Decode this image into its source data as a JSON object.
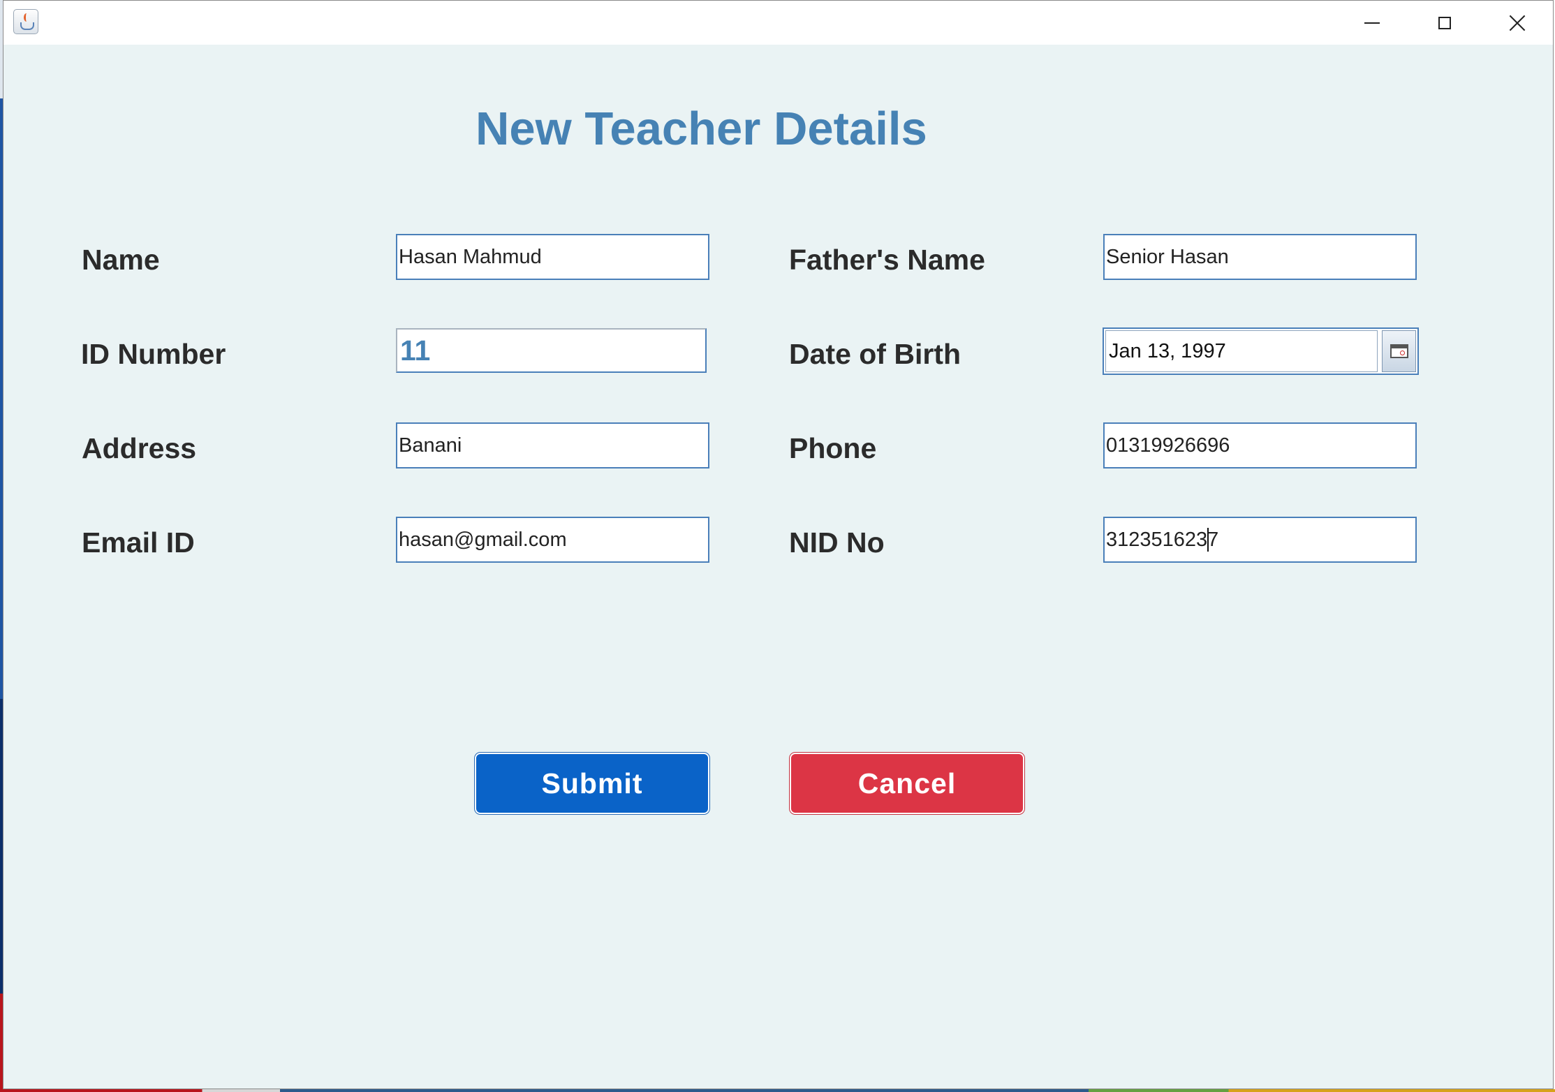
{
  "window": {
    "icon": "java-cup-icon",
    "controls": {
      "minimize": "minimize-icon",
      "maximize": "maximize-icon",
      "close": "close-icon"
    }
  },
  "form": {
    "title": "New Teacher Details",
    "fields": {
      "name": {
        "label": "Name",
        "value": "Hasan Mahmud"
      },
      "fathers_name": {
        "label": "Father's Name",
        "value": "Senior Hasan"
      },
      "id_number": {
        "label": "ID Number",
        "value": "11"
      },
      "date_of_birth": {
        "label": "Date of Birth",
        "value": "Jan 13, 1997",
        "button_icon": "calendar-icon"
      },
      "address": {
        "label": "Address",
        "value": "Banani"
      },
      "phone": {
        "label": "Phone",
        "value": "01319926696"
      },
      "email": {
        "label": "Email ID",
        "value": "hasan@gmail.com"
      },
      "nid": {
        "label": "NID No",
        "value": "3123516237"
      }
    },
    "buttons": {
      "submit": "Submit",
      "cancel": "Cancel"
    }
  },
  "colors": {
    "background": "#eaf3f4",
    "title": "#4682b4",
    "label": "#2b2b2b",
    "field_border": "#4a7fb9",
    "submit": "#0a63c8",
    "cancel": "#dc3545"
  }
}
